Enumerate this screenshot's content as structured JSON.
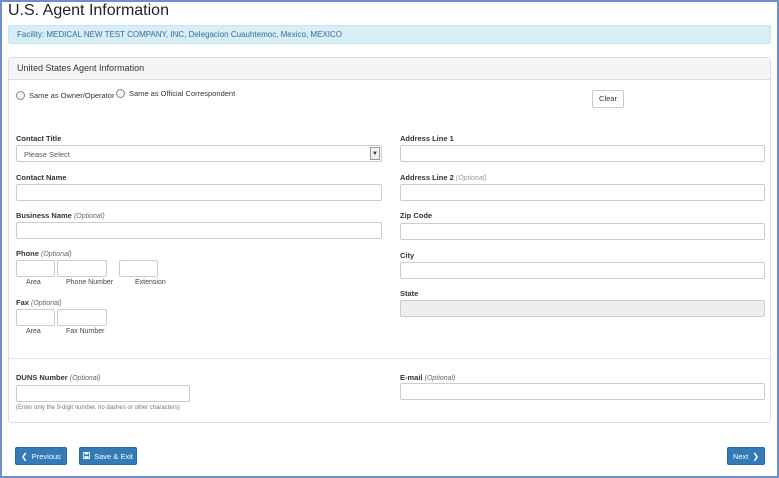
{
  "page": {
    "title": "U.S. Agent Information"
  },
  "facility": {
    "text": "Facility:  MEDICAL NEW TEST COMPANY, INC, Delegacion Cuauhtemoc, Mexico, MEXICO"
  },
  "panel": {
    "heading": "United States Agent Information"
  },
  "options": {
    "same_owner": "Same as Owner/Operator",
    "same_correspondent": "Same as Official Correspondent",
    "clear_label": "Clear"
  },
  "left": {
    "contact_title": "Contact Title",
    "contact_title_value": "Please Select",
    "contact_name": "Contact Name",
    "business_name": "Business Name",
    "phone": "Phone",
    "phone_area": "Area",
    "phone_number": "Phone Number",
    "phone_extension": "Extension",
    "fax": "Fax",
    "fax_area": "Area",
    "fax_number": "Fax Number",
    "duns": "DUNS Number",
    "duns_help": "(Enter only the 9-digit number, no dashes or other characters)"
  },
  "right": {
    "address1": "Address Line 1",
    "address2": "Address Line 2",
    "zip": "Zip Code",
    "city": "City",
    "state": "State",
    "email": "E-mail"
  },
  "optional_label": "(Optional)",
  "footer": {
    "previous": "Previous",
    "save_exit": "Save & Exit",
    "next": "Next"
  },
  "icons": {
    "previous": "chevron-left-icon",
    "save": "floppy-disk-icon",
    "next": "chevron-right-icon",
    "dropdown": "caret-down-icon"
  },
  "colors": {
    "primary": "#337ab7",
    "info_bg": "#d9edf7",
    "info_text": "#31708f",
    "frame": "#6f8fc9"
  }
}
